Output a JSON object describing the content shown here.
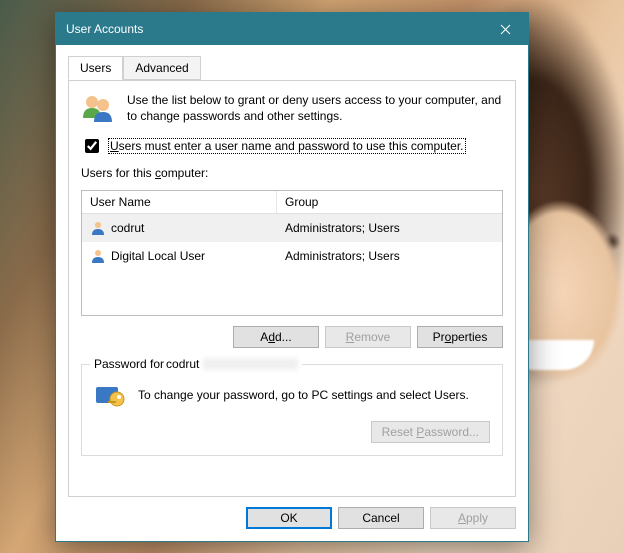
{
  "window": {
    "title": "User Accounts"
  },
  "tabs": {
    "users": "Users",
    "advanced": "Advanced"
  },
  "intro": "Use the list below to grant or deny users access to your computer, and to change passwords and other settings.",
  "checkbox": {
    "checked": true,
    "label_pre": "U",
    "label_rest": "sers must enter a user name and password to use this computer."
  },
  "list_label_pre": "Users for this ",
  "list_label_rest": "computer:",
  "columns": {
    "user": "User Name",
    "group": "Group"
  },
  "users": [
    {
      "name": "codrut",
      "group": "Administrators; Users",
      "selected": true,
      "redacted": true
    },
    {
      "name": "Digital Local User",
      "group": "Administrators; Users",
      "selected": false,
      "redacted": false
    }
  ],
  "buttons": {
    "add": "Add...",
    "remove": "Remove",
    "properties": "Properties",
    "ok": "OK",
    "cancel": "Cancel",
    "apply": "Apply",
    "reset": "Reset Password..."
  },
  "password_box": {
    "title_prefix": "Password for ",
    "title_user": "codrut",
    "text": "To change your password, go to PC settings and select Users."
  }
}
